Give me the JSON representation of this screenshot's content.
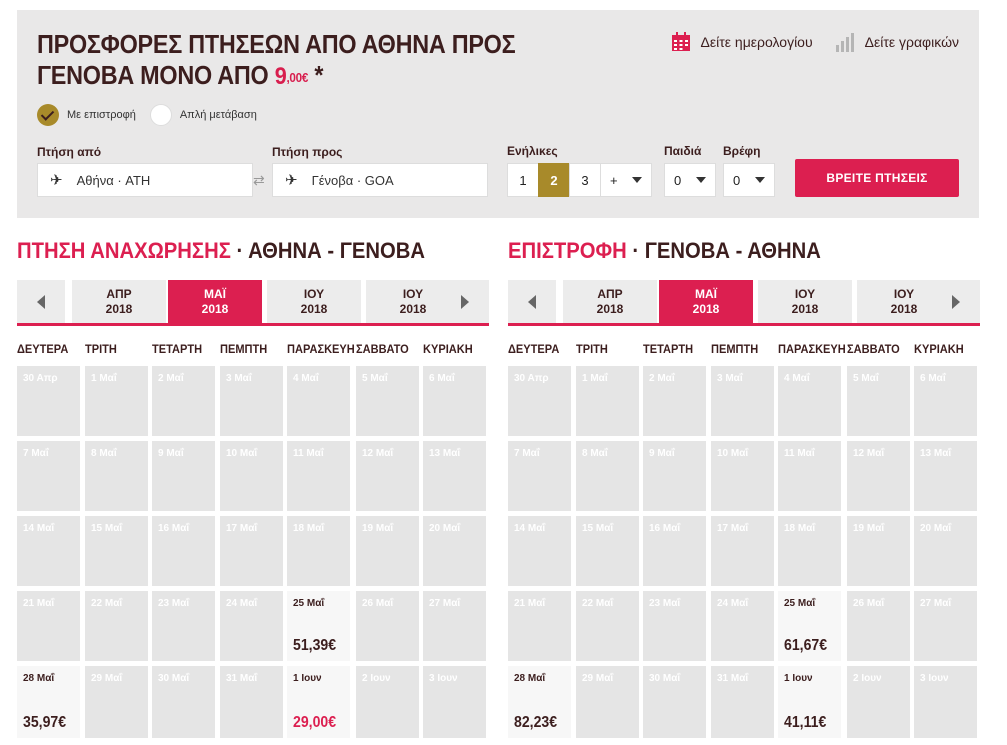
{
  "header": {
    "title_line1": "ΠΡΟΣΦΟΡΕΣ ΠΤΗΣΕΩΝ ΑΠΟ ΑΘΗΝΑ ΠΡΟΣ",
    "title_line2": "ΓΕΝΟΒΑ ΜΟΝΟ ΑΠΟ",
    "price_int": "9",
    "price_dec": ",00€",
    "asterisk": "*",
    "calendar_link": "Δείτε ημερολογίου",
    "graph_link": "Δείτε γραφικών"
  },
  "trip_type": {
    "return_label": "Με επιστροφή",
    "oneway_label": "Απλή μετάβαση",
    "selected": "return"
  },
  "form": {
    "from_label": "Πτήση από",
    "from_value": "Αθήνα · ATH",
    "to_label": "Πτήση προς",
    "to_value": "Γένοβα · GOA",
    "adults_label": "Ενήλικες",
    "adult_options": [
      "1",
      "2",
      "3",
      "+"
    ],
    "adults_selected": "2",
    "children_label": "Παιδιά",
    "children_value": "0",
    "infants_label": "Βρέφη",
    "infants_value": "0",
    "search_button": "ΒΡΕΙΤΕ ΠΤΗΣΕΙΣ"
  },
  "colors": {
    "accent": "#dc1f50",
    "gold": "#a88a2a",
    "dark": "#3c1e1e"
  },
  "weekdays": [
    "ΔΕΥΤΕΡΑ",
    "ΤΡΙΤΗ",
    "ΤΕΤΑΡΤΗ",
    "ΠΕΜΠΤΗ",
    "ΠΑΡΑΣΚΕΥΗ",
    "ΣΑΒΒΑΤΟ",
    "ΚΥΡΙΑΚΗ"
  ],
  "outbound": {
    "title_hl": "ΠΤΗΣΗ ΑΝΑΧΩΡΗΣΗΣ",
    "title_rest": " · ΑΘΗΝΑ - ΓΕΝΟΒΑ",
    "months": [
      {
        "m": "ΑΠΡ",
        "y": "2018",
        "selected": false
      },
      {
        "m": "ΜΑΪ",
        "y": "2018",
        "selected": true
      },
      {
        "m": "ΙΟΥ",
        "y": "2018",
        "selected": false
      },
      {
        "m": "ΙΟΥ",
        "y": "2018",
        "selected": false
      }
    ],
    "cells": [
      {
        "d": "30 Απρ"
      },
      {
        "d": "1 Μαΐ"
      },
      {
        "d": "2 Μαΐ"
      },
      {
        "d": "3 Μαΐ"
      },
      {
        "d": "4 Μαΐ"
      },
      {
        "d": "5 Μαΐ"
      },
      {
        "d": "6 Μαΐ"
      },
      {
        "d": "7 Μαΐ"
      },
      {
        "d": "8 Μαΐ"
      },
      {
        "d": "9 Μαΐ"
      },
      {
        "d": "10 Μαΐ"
      },
      {
        "d": "11 Μαΐ"
      },
      {
        "d": "12 Μαΐ"
      },
      {
        "d": "13 Μαΐ"
      },
      {
        "d": "14 Μαΐ"
      },
      {
        "d": "15 Μαΐ"
      },
      {
        "d": "16 Μαΐ"
      },
      {
        "d": "17 Μαΐ"
      },
      {
        "d": "18 Μαΐ"
      },
      {
        "d": "19 Μαΐ"
      },
      {
        "d": "20 Μαΐ"
      },
      {
        "d": "21 Μαΐ"
      },
      {
        "d": "22 Μαΐ"
      },
      {
        "d": "23 Μαΐ"
      },
      {
        "d": "24 Μαΐ"
      },
      {
        "d": "25 Μαΐ",
        "p": "51,39€"
      },
      {
        "d": "26 Μαΐ"
      },
      {
        "d": "27 Μαΐ"
      },
      {
        "d": "28 Μαΐ",
        "p": "35,97€"
      },
      {
        "d": "29 Μαΐ"
      },
      {
        "d": "30 Μαΐ"
      },
      {
        "d": "31 Μαΐ"
      },
      {
        "d": "1 Ιουν",
        "p": "29,00€",
        "cheap": true
      },
      {
        "d": "2 Ιουν"
      },
      {
        "d": "3 Ιουν"
      }
    ]
  },
  "inbound": {
    "title_hl": "ΕΠΙΣΤΡΟΦΗ",
    "title_rest": " · ΓΕΝΟΒΑ - ΑΘΗΝΑ",
    "months": [
      {
        "m": "ΑΠΡ",
        "y": "2018",
        "selected": false
      },
      {
        "m": "ΜΑΪ",
        "y": "2018",
        "selected": true
      },
      {
        "m": "ΙΟΥ",
        "y": "2018",
        "selected": false
      },
      {
        "m": "ΙΟΥ",
        "y": "2018",
        "selected": false
      }
    ],
    "cells": [
      {
        "d": "30 Απρ"
      },
      {
        "d": "1 Μαΐ"
      },
      {
        "d": "2 Μαΐ"
      },
      {
        "d": "3 Μαΐ"
      },
      {
        "d": "4 Μαΐ"
      },
      {
        "d": "5 Μαΐ"
      },
      {
        "d": "6 Μαΐ"
      },
      {
        "d": "7 Μαΐ"
      },
      {
        "d": "8 Μαΐ"
      },
      {
        "d": "9 Μαΐ"
      },
      {
        "d": "10 Μαΐ"
      },
      {
        "d": "11 Μαΐ"
      },
      {
        "d": "12 Μαΐ"
      },
      {
        "d": "13 Μαΐ"
      },
      {
        "d": "14 Μαΐ"
      },
      {
        "d": "15 Μαΐ"
      },
      {
        "d": "16 Μαΐ"
      },
      {
        "d": "17 Μαΐ"
      },
      {
        "d": "18 Μαΐ"
      },
      {
        "d": "19 Μαΐ"
      },
      {
        "d": "20 Μαΐ"
      },
      {
        "d": "21 Μαΐ"
      },
      {
        "d": "22 Μαΐ"
      },
      {
        "d": "23 Μαΐ"
      },
      {
        "d": "24 Μαΐ"
      },
      {
        "d": "25 Μαΐ",
        "p": "61,67€"
      },
      {
        "d": "26 Μαΐ"
      },
      {
        "d": "27 Μαΐ"
      },
      {
        "d": "28 Μαΐ",
        "p": "82,23€"
      },
      {
        "d": "29 Μαΐ"
      },
      {
        "d": "30 Μαΐ"
      },
      {
        "d": "31 Μαΐ"
      },
      {
        "d": "1 Ιουν",
        "p": "41,11€"
      },
      {
        "d": "2 Ιουν"
      },
      {
        "d": "3 Ιουν"
      }
    ]
  }
}
